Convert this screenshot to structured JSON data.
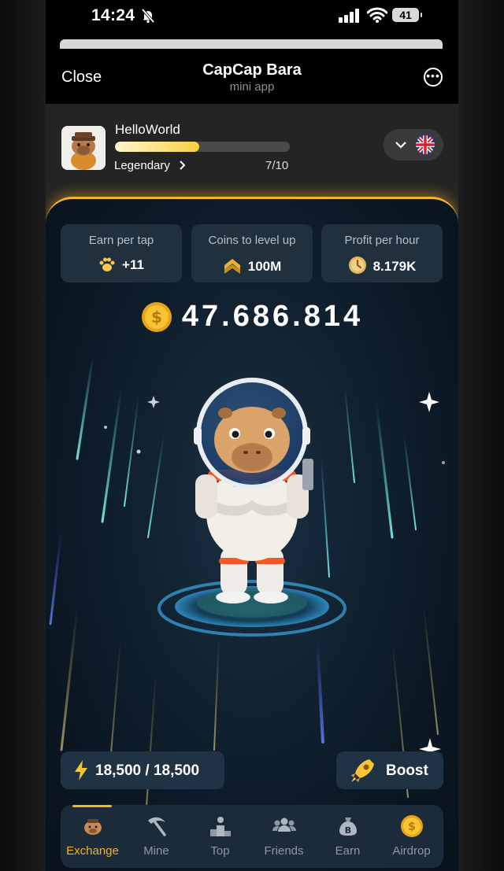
{
  "status_bar": {
    "time": "14:24",
    "battery": "41"
  },
  "header": {
    "close_label": "Close",
    "title": "CapCap Bara",
    "subtitle": "mini app"
  },
  "profile": {
    "username": "HelloWorld",
    "rank": "Legendary",
    "level": "7/10",
    "level_progress": 0.48
  },
  "stats": [
    {
      "label": "Earn per tap",
      "value": "+11",
      "icon": "paw-icon"
    },
    {
      "label": "Coins to level up",
      "value": "100M",
      "icon": "chevron-rank-icon"
    },
    {
      "label": "Profit per hour",
      "value": "8.179K",
      "icon": "clock-coin-icon"
    }
  ],
  "balance": "47.686.814",
  "energy": "18,500 / 18,500",
  "boost_label": "Boost",
  "nav": [
    {
      "label": "Exchange",
      "icon": "capybara-icon",
      "active": true
    },
    {
      "label": "Mine",
      "icon": "pickaxe-icon",
      "active": false
    },
    {
      "label": "Top",
      "icon": "podium-icon",
      "active": false
    },
    {
      "label": "Friends",
      "icon": "friends-icon",
      "active": false
    },
    {
      "label": "Earn",
      "icon": "money-bag-icon",
      "active": false
    },
    {
      "label": "Airdrop",
      "icon": "dollar-coin-icon",
      "active": false
    }
  ],
  "colors": {
    "accent": "#f2b32d",
    "panel": "#21303d",
    "background": "#0b1824"
  }
}
